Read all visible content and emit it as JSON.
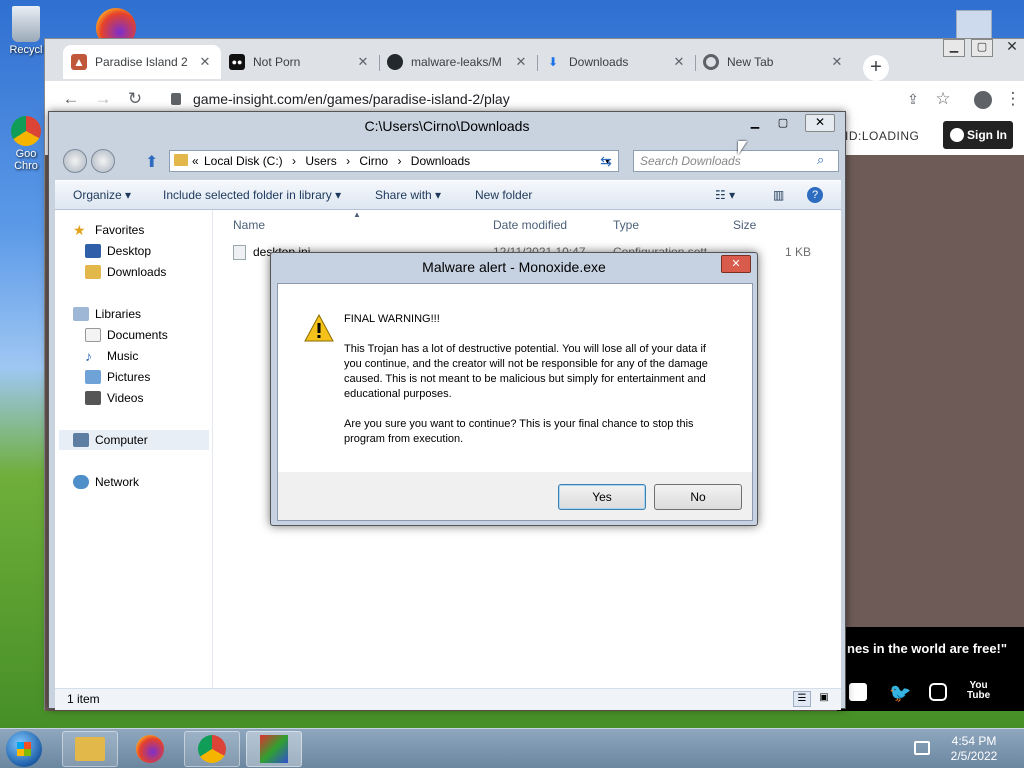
{
  "desktop": {
    "icons": [
      {
        "label": "Recycl",
        "icon": "recycle-bin-icon"
      },
      {
        "label": "Goo Chro",
        "icon": "chrome-shortcut-icon"
      }
    ]
  },
  "browser": {
    "tabs": [
      {
        "title": "Paradise Island 2",
        "icon": "game-icon",
        "active": true
      },
      {
        "title": "Not Porn",
        "icon": "video-icon"
      },
      {
        "title": "malware-leaks/M",
        "icon": "github-icon"
      },
      {
        "title": "Downloads",
        "icon": "download-icon"
      },
      {
        "title": "New Tab",
        "icon": "chrome-icon"
      }
    ],
    "new_tab": "+",
    "url": "game-insight.com/en/games/paradise-island-2/play",
    "site": {
      "id_text": "ID:LOADING",
      "sign_in": "Sign In",
      "promo": "nes in the world are free!\""
    }
  },
  "explorer": {
    "title": "C:\\Users\\Cirno\\Downloads",
    "breadcrumb": [
      "Local Disk (C:)",
      "Users",
      "Cirno",
      "Downloads"
    ],
    "search_placeholder": "Search Downloads",
    "commands": [
      "Organize",
      "Include selected folder in library",
      "Share with",
      "New folder"
    ],
    "nav": {
      "favorites": "Favorites",
      "favorites_items": [
        "Desktop",
        "Downloads"
      ],
      "libraries": "Libraries",
      "library_items": [
        "Documents",
        "Music",
        "Pictures",
        "Videos"
      ],
      "computer": "Computer",
      "network": "Network"
    },
    "columns": [
      "Name",
      "Date modified",
      "Type",
      "Size"
    ],
    "files": [
      {
        "name": "desktop.ini",
        "date": "12/11/2021 10:47",
        "type": "Configuration sett",
        "size": "1 KB"
      }
    ],
    "status": "1 item"
  },
  "dialog": {
    "title": "Malware alert - Monoxide.exe",
    "heading": "FINAL WARNING!!!",
    "paragraph1": "This Trojan has a lot of destructive potential. You will lose all of your data if you continue, and the creator will not be responsible for any of the damage caused. This is not meant to be malicious but simply for entertainment and educational purposes.",
    "paragraph2": "Are you sure you want to continue? This is your final chance to stop this program from execution.",
    "yes": "Yes",
    "no": "No"
  },
  "taskbar": {
    "time": "4:54 PM",
    "date": "2/5/2022",
    "apps": [
      "explorer-icon",
      "firefox-icon",
      "chrome-icon",
      "monoxide-icon"
    ]
  }
}
